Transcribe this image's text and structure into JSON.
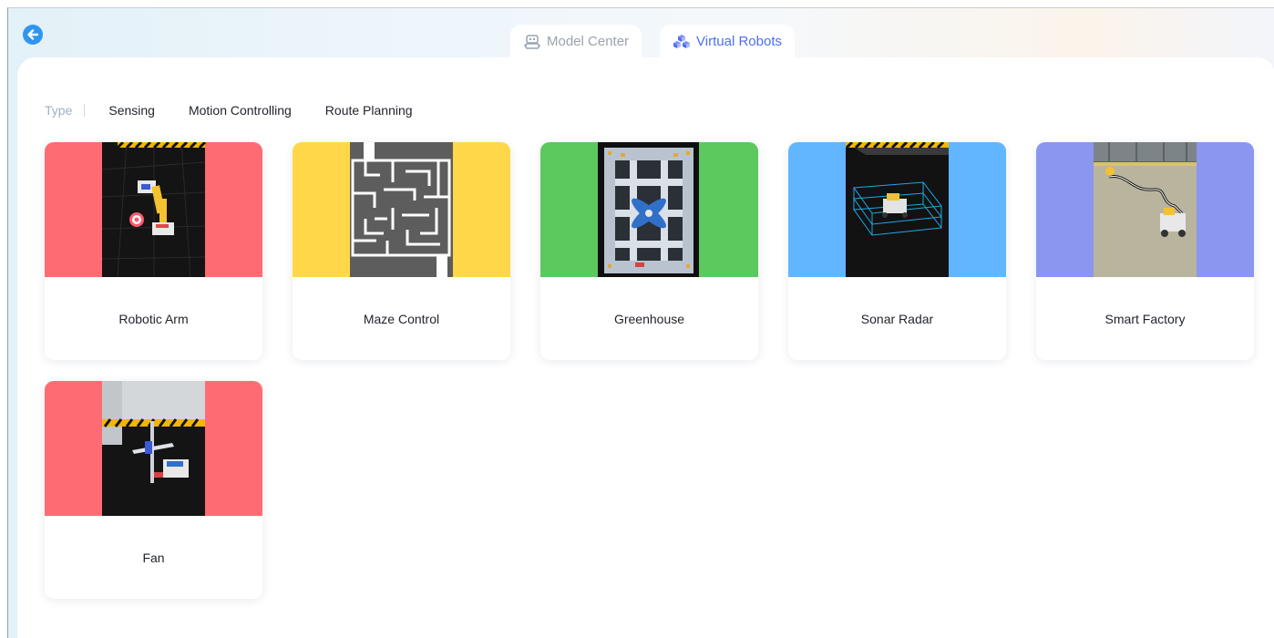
{
  "header": {
    "tabs": [
      {
        "label": "Model Center",
        "active": false,
        "icon": "robot-icon"
      },
      {
        "label": "Virtual Robots",
        "active": true,
        "icon": "cubes-icon"
      }
    ]
  },
  "filters": {
    "type_label": "Type",
    "items": [
      "Sensing",
      "Motion Controlling",
      "Route Planning"
    ]
  },
  "cards": [
    {
      "title": "Robotic Arm",
      "color": "#ff6b72"
    },
    {
      "title": "Maze Control",
      "color": "#ffd84a"
    },
    {
      "title": "Greenhouse",
      "color": "#5cc95e"
    },
    {
      "title": "Sonar Radar",
      "color": "#62b6ff"
    },
    {
      "title": "Smart Factory",
      "color": "#8a96ef"
    },
    {
      "title": "Fan",
      "color": "#ff6b72"
    }
  ],
  "colors": {
    "accent": "#4c6ef5",
    "back_button": "#2f96f0"
  }
}
